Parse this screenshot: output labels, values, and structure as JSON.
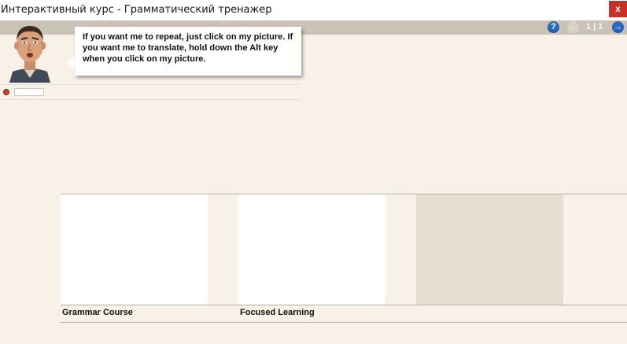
{
  "window": {
    "title": "Интерактивный курс - Грамматический тренажер",
    "close_label": "x"
  },
  "toolbar": {
    "help_label": "?",
    "prev_label": "←",
    "next_label": "→",
    "page_indicator": "1 | 1"
  },
  "assistant": {
    "avatar_icon": "presenter-face-icon",
    "message": "If you want me to repeat, just click on my picture. If you want me to translate, hold down the Alt key when you click on my picture."
  },
  "recorder": {
    "indicator_color": "#d2371f"
  },
  "courses": [
    {
      "label": "Grammar Course"
    },
    {
      "label": "Focused Learning"
    },
    {
      "label": ""
    }
  ],
  "colors": {
    "background": "#f7f1e7",
    "toolbar": "#c9c2b6",
    "close": "#c8302a",
    "nav_blue": "#2b6bc2",
    "placeholder_card": "#e4ddd2"
  }
}
